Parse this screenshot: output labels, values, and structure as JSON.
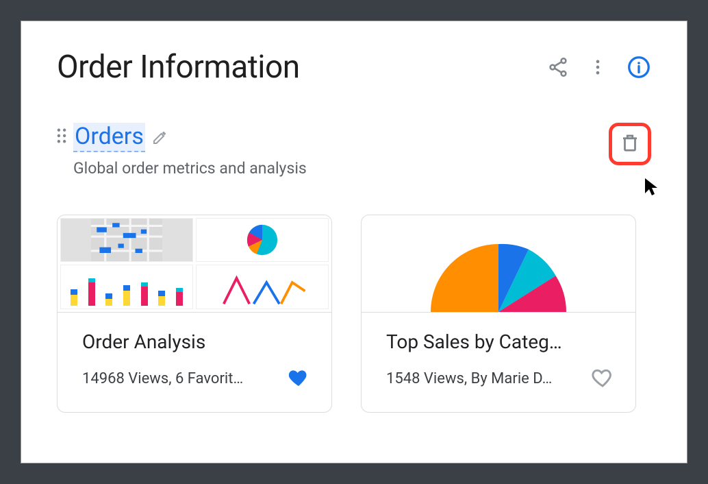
{
  "header": {
    "title": "Order Information"
  },
  "section": {
    "name": "Orders",
    "description": "Global order metrics and analysis"
  },
  "cards": [
    {
      "title": "Order Analysis",
      "meta": "14968 Views, 6 Favorit…",
      "favorited": true
    },
    {
      "title": "Top Sales by Categ…",
      "meta": "1548 Views, By Marie D…",
      "favorited": false
    }
  ],
  "colors": {
    "accent": "#1a73e8",
    "highlight": "#ff3b30",
    "teal": "#00bcd4",
    "orange": "#ff8f00",
    "pink": "#e91e63",
    "blue": "#1a73e8"
  }
}
